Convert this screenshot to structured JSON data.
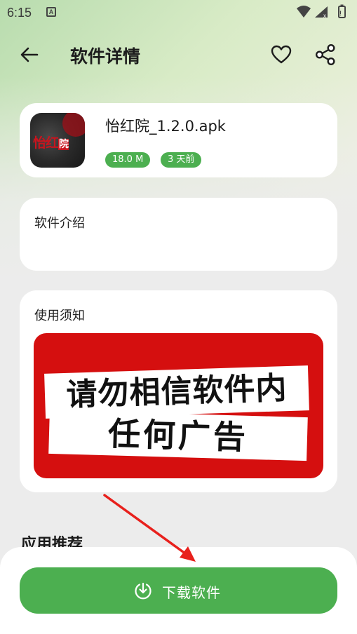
{
  "status_bar": {
    "time": "6:15",
    "icons": [
      "text-a-icon",
      "wifi-icon",
      "signal-icon",
      "battery-icon"
    ]
  },
  "app_bar": {
    "title": "软件详情",
    "icons": [
      "arrow-left-icon",
      "heart-icon",
      "share-icon"
    ]
  },
  "app_info": {
    "name": "怡红院_1.2.0.apk",
    "icon_text": "怡红",
    "icon_box_text": "院",
    "size": "18.0 M",
    "updated": "3 天前"
  },
  "intro": {
    "label": "软件介绍"
  },
  "notice": {
    "label": "使用须知",
    "banner_line1": "请勿相信软件内",
    "banner_line2": "任何广告"
  },
  "recommend": {
    "title": "应用推荐"
  },
  "download": {
    "label": "下载软件",
    "icon": "download-icon"
  },
  "colors": {
    "accent_green": "#4caf50",
    "banner_red": "#d50f0f",
    "annotation_arrow": "#e8201c"
  }
}
